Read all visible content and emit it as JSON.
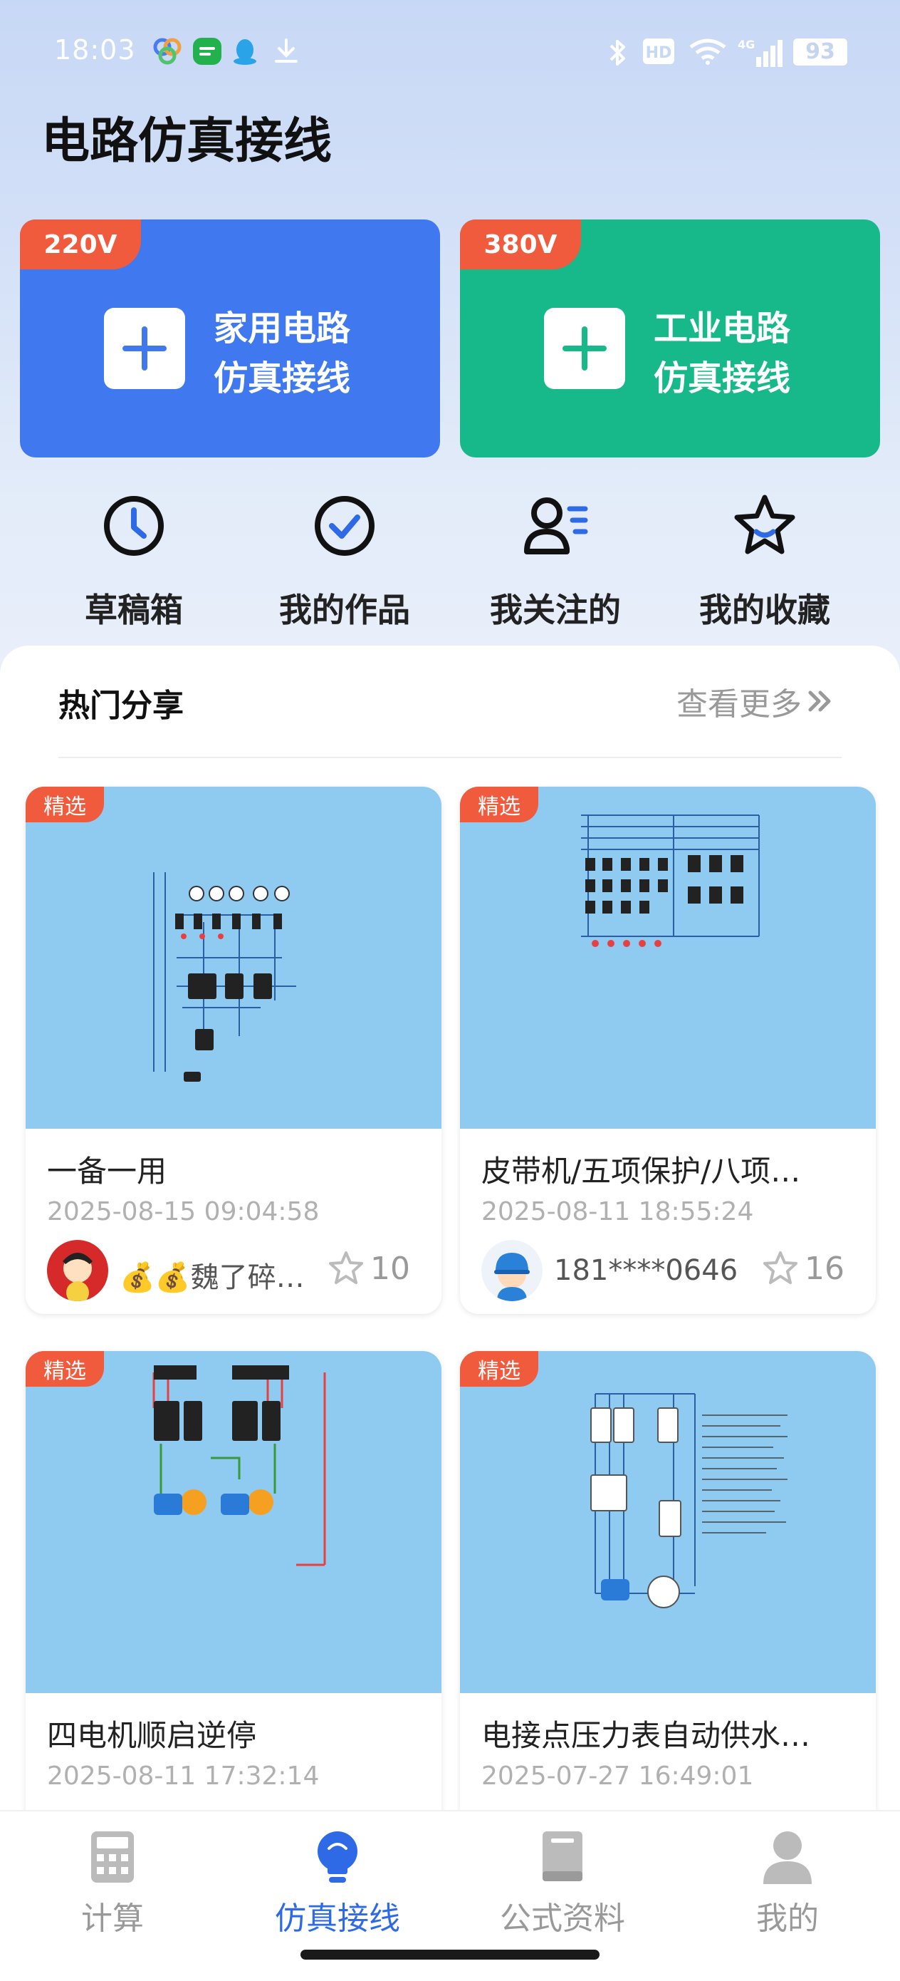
{
  "status_bar": {
    "time": "18:03",
    "left_icons": [
      "app-icon",
      "wechat-icon",
      "qq-icon",
      "download-icon"
    ],
    "right_icons": [
      "bluetooth-icon",
      "hd-icon",
      "wifi-icon",
      "signal-4g-icon"
    ],
    "network": "4G",
    "hd": "HD",
    "battery": "93"
  },
  "page": {
    "title": "电路仿真接线"
  },
  "big_cards": [
    {
      "tag": "220V",
      "line1": "家用电路",
      "line2": "仿真接线",
      "color": "#3f78ef"
    },
    {
      "tag": "380V",
      "line1": "工业电路",
      "line2": "仿真接线",
      "color": "#17b88a"
    }
  ],
  "quick_menu": [
    {
      "label": "草稿箱",
      "icon": "clock-icon"
    },
    {
      "label": "我的作品",
      "icon": "check-circle-icon"
    },
    {
      "label": "我关注的",
      "icon": "user-follow-icon"
    },
    {
      "label": "我的收藏",
      "icon": "star-icon"
    }
  ],
  "section": {
    "title": "热门分享",
    "more": "查看更多"
  },
  "cards": [
    {
      "tag": "精选",
      "title": "一备一用",
      "time": "2025-08-15 09:04:58",
      "author": "💰💰魏了碎…",
      "stars": "10"
    },
    {
      "tag": "精选",
      "title": "皮带机/五项保护/八项…",
      "time": "2025-08-11 18:55:24",
      "author": "181****0646",
      "stars": "16"
    },
    {
      "tag": "精选",
      "title": "四电机顺启逆停",
      "time": "2025-08-11 17:32:14",
      "author": "",
      "stars": ""
    },
    {
      "tag": "精选",
      "title": "电接点压力表自动供水…",
      "time": "2025-07-27 16:49:01",
      "author": "",
      "stars": ""
    }
  ],
  "bottom_nav": [
    {
      "label": "计算",
      "icon": "calculator-icon",
      "active": false
    },
    {
      "label": "仿真接线",
      "icon": "bulb-icon",
      "active": true
    },
    {
      "label": "公式资料",
      "icon": "book-icon",
      "active": false
    },
    {
      "label": "我的",
      "icon": "person-icon",
      "active": false
    }
  ],
  "colors": {
    "accent": "#2f6ae6",
    "tag": "#f05a3d",
    "thumb": "#8fcbf1"
  }
}
